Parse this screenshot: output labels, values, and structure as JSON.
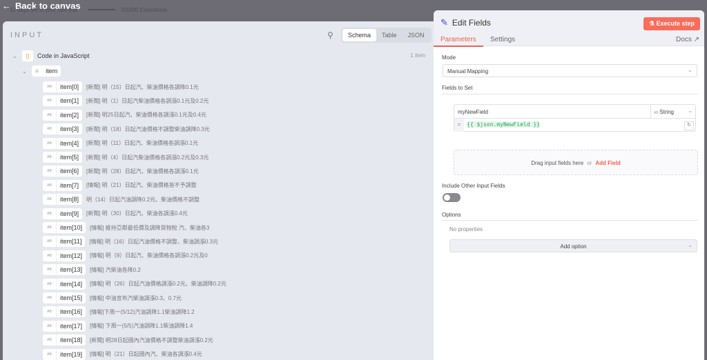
{
  "topbar": {
    "back": "Back to canvas",
    "trial": "12 days left in your n8n trial",
    "executions": "0/1000 Executions",
    "executions_progress": 0
  },
  "input": {
    "title": "INPUT",
    "views": [
      "Schema",
      "Table",
      "JSON"
    ],
    "active_view": "Schema",
    "count": "1 item",
    "node": "Code in JavaScript",
    "node_icon": "braces-icon",
    "root": "item",
    "items": [
      {
        "k": "item[0]",
        "v": "[新聞] 明（15）日起汽、柴油價格各調降0.1元"
      },
      {
        "k": "item[1]",
        "v": "[新聞] 明（1）日起汽柴油價格各調漲0.1元及0.2元"
      },
      {
        "k": "item[2]",
        "v": "[新聞] 明25日起汽、柴油價格各調漲0.1元及0.4元"
      },
      {
        "k": "item[3]",
        "v": "[新聞] 明（18）日起汽油價格不調整柴油調降0.3元"
      },
      {
        "k": "item[4]",
        "v": "[新聞] 明（11）日起汽、柴油價格各調漲0.1元"
      },
      {
        "k": "item[5]",
        "v": "[新聞] 明（4）日起汽柴油價格各調漲0.2元及0.3元"
      },
      {
        "k": "item[6]",
        "v": "[新聞] 明（28）日起汽、柴油價格各調漲0.1元"
      },
      {
        "k": "item[7]",
        "v": "[情報] 明（21）日起汽、柴油價格皆不予調整"
      },
      {
        "k": "item[8]",
        "v": "明（14）日起汽油調降0.2元、柴油價格不調整"
      },
      {
        "k": "item[9]",
        "v": "[新聞] 明（30）日起汽、柴油各調漲0.4元"
      },
      {
        "k": "item[10]",
        "v": "[情報] 維持亞鄰最低價及調降貨物稅 汽、柴油各3"
      },
      {
        "k": "item[11]",
        "v": "[情報] 明（16）日起汽油價格不調整，柴油調漲0.3元"
      },
      {
        "k": "item[12]",
        "v": "[情報] 明（9）日起汽、柴油價格各調漲0.2元及0"
      },
      {
        "k": "item[13]",
        "v": "[情報] 汽柴油各降0.2"
      },
      {
        "k": "item[14]",
        "v": "[情報] 明（26）日起汽油價格調漲0.2元、柴油調降0.2元"
      },
      {
        "k": "item[15]",
        "v": "[情報] 中油宣布汽柴油調漲0.3、0.7元"
      },
      {
        "k": "item[16]",
        "v": "[情報]下周一(5/12)汽油調降1.1柴油調降1.2"
      },
      {
        "k": "item[17]",
        "v": "[情報] 下周一(5/5)汽油調降1.1柴油調降1.4"
      },
      {
        "k": "item[18]",
        "v": "[新聞] 明28日起國內汽油價格不調整柴油調漲0.2元"
      },
      {
        "k": "item[19]",
        "v": "[情報] 明（21）日起國內汽、柴油各調漲0.4元"
      }
    ]
  },
  "panel": {
    "title": "Edit Fields",
    "execute": "Execute step",
    "tabs": [
      "Parameters",
      "Settings"
    ],
    "docs": "Docs",
    "mode_label": "Mode",
    "mode_value": "Manual Mapping",
    "fields_label": "Fields to Set",
    "field_name": "myNewField",
    "field_type": "String",
    "field_value": "{{ $json.myNewField }}",
    "drop_text": "Drag input fields here",
    "drop_or": "or",
    "add_field": "Add Field",
    "include_label": "Include Other Input Fields",
    "include_on": false,
    "options_label": "Options",
    "no_props": "No properties",
    "add_option": "Add option",
    "accent": "#f0604a"
  }
}
